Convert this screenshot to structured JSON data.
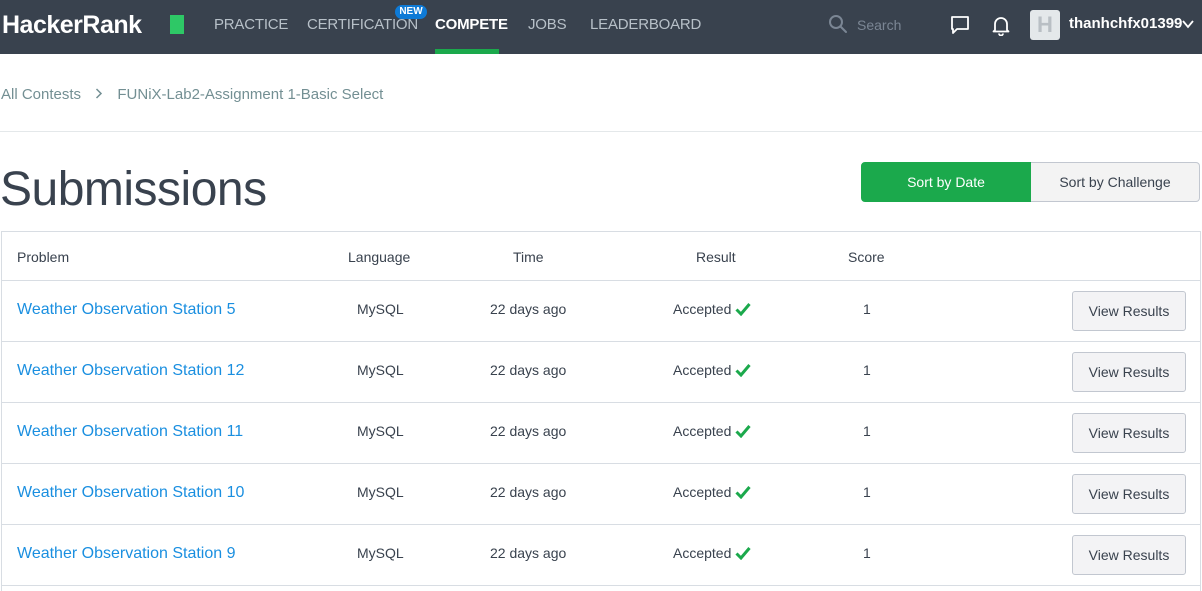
{
  "navbar": {
    "logo": "HackerRank",
    "items": [
      {
        "label": "PRACTICE"
      },
      {
        "label": "CERTIFICATION",
        "badge": "NEW"
      },
      {
        "label": "COMPETE",
        "active": true
      },
      {
        "label": "JOBS"
      },
      {
        "label": "LEADERBOARD"
      }
    ],
    "search_placeholder": "Search",
    "username": "thanhchfx01399",
    "avatar_letter": "H",
    "colors": {
      "bg": "#39424e",
      "accent": "#1ba94c",
      "badge": "#0e7ad6"
    }
  },
  "breadcrumb": {
    "root": "All Contests",
    "current": "FUNiX-Lab2-Assignment 1-Basic Select"
  },
  "page": {
    "title": "Submissions",
    "sort_by_date": "Sort by Date",
    "sort_by_challenge": "Sort by Challenge"
  },
  "table": {
    "headers": {
      "problem": "Problem",
      "language": "Language",
      "time": "Time",
      "result": "Result",
      "score": "Score"
    },
    "rows": [
      {
        "problem": "Weather Observation Station 5",
        "language": "MySQL",
        "time": "22 days ago",
        "result": "Accepted",
        "score": "1",
        "action": "View Results"
      },
      {
        "problem": "Weather Observation Station 12",
        "language": "MySQL",
        "time": "22 days ago",
        "result": "Accepted",
        "score": "1",
        "action": "View Results"
      },
      {
        "problem": "Weather Observation Station 11",
        "language": "MySQL",
        "time": "22 days ago",
        "result": "Accepted",
        "score": "1",
        "action": "View Results"
      },
      {
        "problem": "Weather Observation Station 10",
        "language": "MySQL",
        "time": "22 days ago",
        "result": "Accepted",
        "score": "1",
        "action": "View Results"
      },
      {
        "problem": "Weather Observation Station 9",
        "language": "MySQL",
        "time": "22 days ago",
        "result": "Accepted",
        "score": "1",
        "action": "View Results"
      }
    ],
    "icons": {
      "accepted": "check-icon"
    },
    "colors": {
      "link": "#1a8fe0",
      "check": "#1ba94c"
    }
  }
}
